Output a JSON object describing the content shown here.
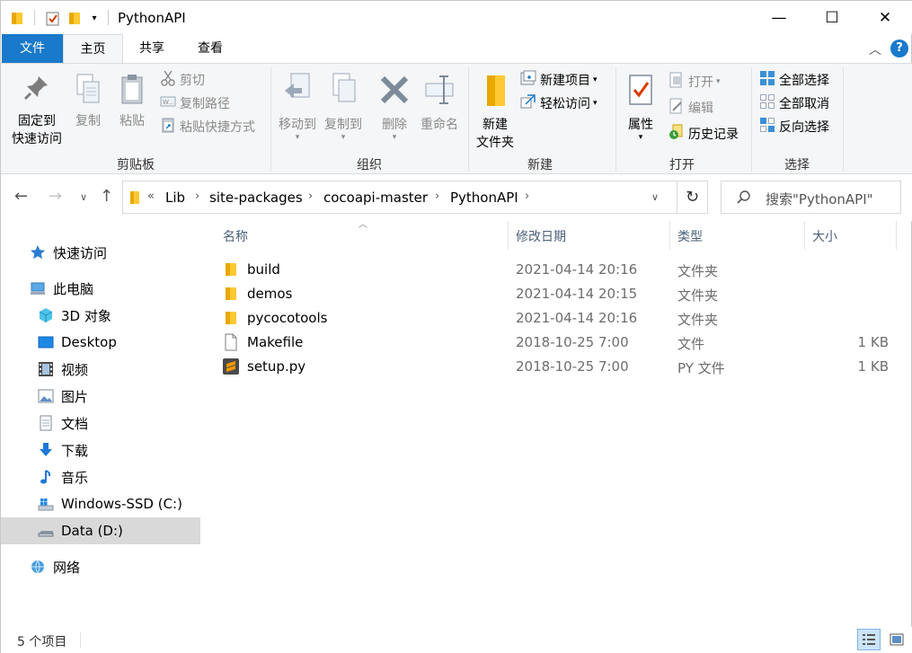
{
  "window": {
    "title": "PythonAPI",
    "minimize": "—",
    "maximize": "☐",
    "close": "✕"
  },
  "tabs": [
    "文件",
    "主页",
    "共享",
    "查看"
  ],
  "ribbon": {
    "clipboard": {
      "pin_label_1": "固定到",
      "pin_label_2": "快速访问",
      "copy": "复制",
      "paste": "粘贴",
      "cut": "剪切",
      "copy_path": "复制路径",
      "paste_shortcut": "粘贴快捷方式",
      "group": "剪贴板"
    },
    "organize": {
      "move_to": "移动到",
      "copy_to": "复制到",
      "delete": "删除",
      "rename": "重命名",
      "group": "组织"
    },
    "new": {
      "new_folder_1": "新建",
      "new_folder_2": "文件夹",
      "new_item": "新建项目",
      "easy_access": "轻松访问",
      "group": "新建"
    },
    "open": {
      "properties": "属性",
      "open": "打开",
      "edit": "编辑",
      "history": "历史记录",
      "group": "打开"
    },
    "select": {
      "select_all": "全部选择",
      "select_none": "全部取消",
      "invert": "反向选择",
      "group": "选择"
    }
  },
  "address": {
    "overflow": "«",
    "crumbs": [
      "Lib",
      "site-packages",
      "cocoapi-master",
      "PythonAPI"
    ],
    "search_placeholder": "搜索\"PythonAPI\""
  },
  "navpane": {
    "quick_access": "快速访问",
    "this_pc": "此电脑",
    "items": [
      "3D 对象",
      "Desktop",
      "视频",
      "图片",
      "文档",
      "下载",
      "音乐",
      "Windows-SSD (C:)",
      "Data (D:)"
    ],
    "network": "网络"
  },
  "columns": {
    "name": "名称",
    "modified": "修改日期",
    "type": "类型",
    "size": "大小"
  },
  "files": [
    {
      "name": "build",
      "modified": "2021-04-14 20:16",
      "type": "文件夹",
      "size": "",
      "icon": "folder-icon"
    },
    {
      "name": "demos",
      "modified": "2021-04-14 20:15",
      "type": "文件夹",
      "size": "",
      "icon": "folder-icon"
    },
    {
      "name": "pycocotools",
      "modified": "2021-04-14 20:16",
      "type": "文件夹",
      "size": "",
      "icon": "folder-icon"
    },
    {
      "name": "Makefile",
      "modified": "2018-10-25 7:00",
      "type": "文件",
      "size": "1 KB",
      "icon": "file-icon"
    },
    {
      "name": "setup.py",
      "modified": "2018-10-25 7:00",
      "type": "PY 文件",
      "size": "1 KB",
      "icon": "sublime-file-icon"
    }
  ],
  "status": {
    "count": "5 个项目"
  },
  "colors": {
    "accent": "#1979ca",
    "folder": "#ffc933",
    "selection": "#d9d9d9"
  }
}
